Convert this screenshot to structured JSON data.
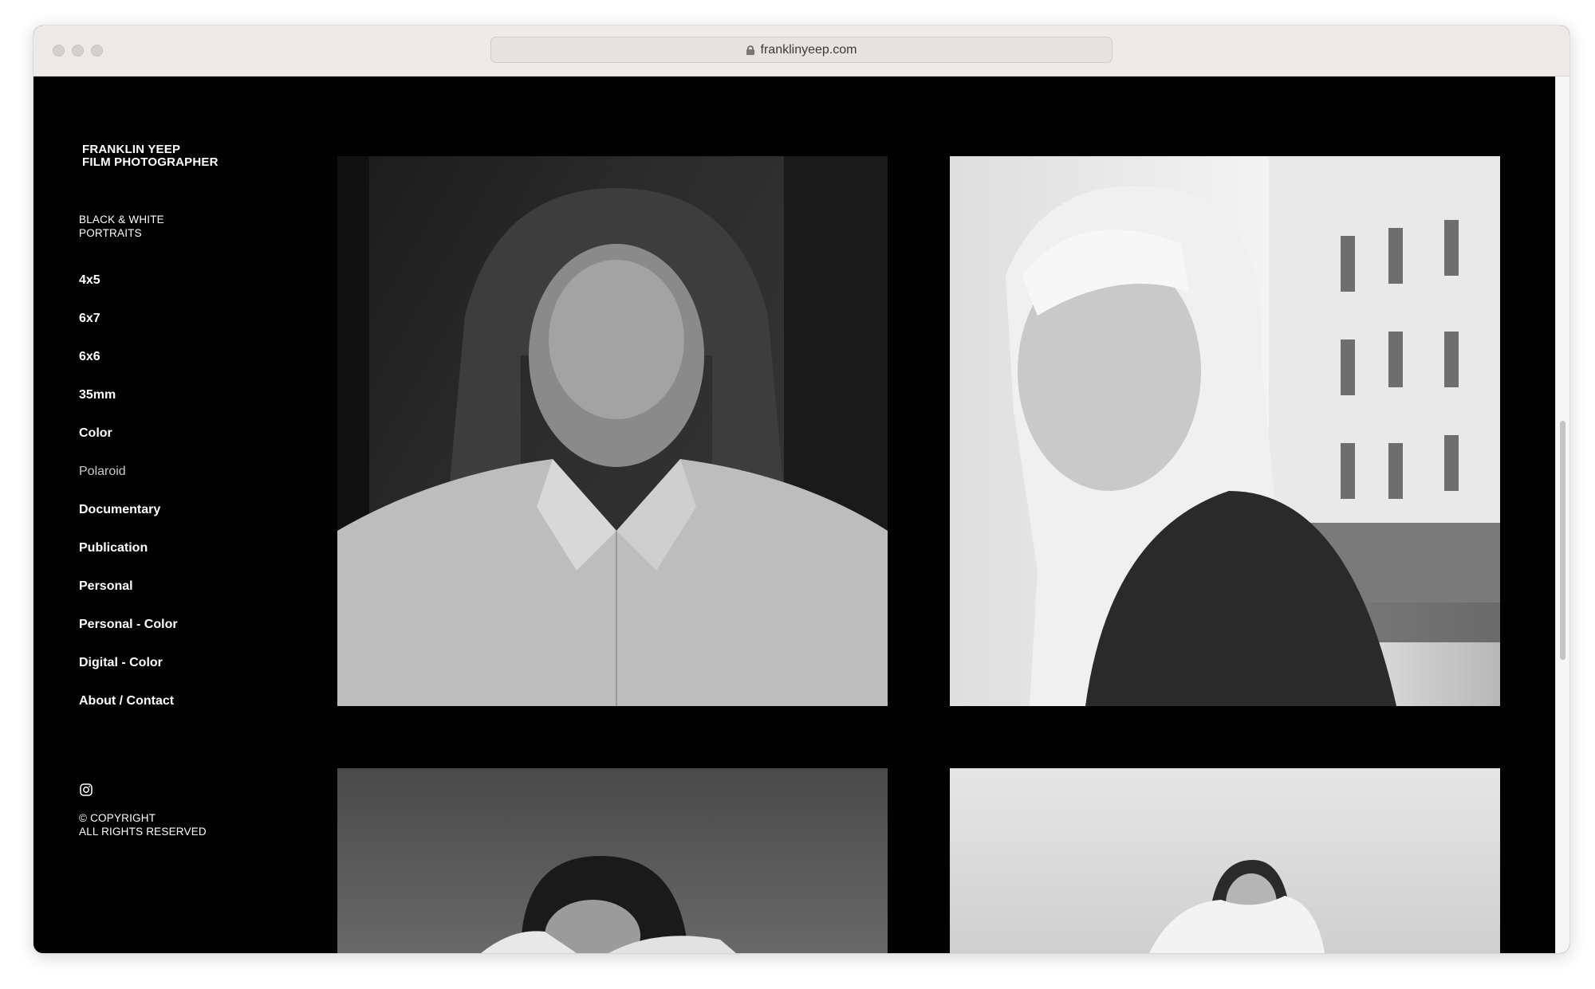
{
  "browser": {
    "url": "franklinyeep.com",
    "icons": {
      "lock": "lock-icon"
    }
  },
  "sidebar": {
    "brand_line1": "FRANKLIN YEEP",
    "brand_line2": "FILM PHOTOGRAPHER",
    "category_line1": "BLACK & WHITE",
    "category_line2": "PORTRAITS",
    "nav": [
      {
        "label": "4x5"
      },
      {
        "label": "6x7"
      },
      {
        "label": "6x6"
      },
      {
        "label": "35mm"
      },
      {
        "label": "Color"
      },
      {
        "label": "Polaroid"
      },
      {
        "label": "Documentary"
      },
      {
        "label": "Publication"
      },
      {
        "label": "Personal"
      },
      {
        "label": "Personal - Color"
      },
      {
        "label": "Digital - Color"
      },
      {
        "label": "About / Contact"
      }
    ],
    "social_icon": "instagram-icon",
    "copyright_line1": "© COPYRIGHT",
    "copyright_line2": "ALL RIGHTS RESERVED"
  },
  "colors": {
    "page_background": "#000000",
    "text": "#ffffff",
    "dimmed_nav": "#c9c9c9"
  }
}
